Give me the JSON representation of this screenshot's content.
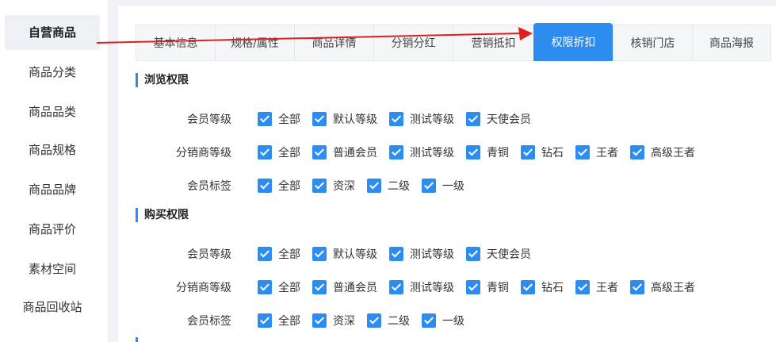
{
  "sidebar": {
    "items": [
      {
        "label": "自营商品",
        "active": true
      },
      {
        "label": "商品分类"
      },
      {
        "label": "商品品类"
      },
      {
        "label": "商品规格"
      },
      {
        "label": "商品品牌"
      },
      {
        "label": "商品评价"
      },
      {
        "label": "素材空间"
      },
      {
        "label": "商品回收站"
      }
    ]
  },
  "tabs": [
    {
      "label": "基本信息"
    },
    {
      "label": "规格/属性"
    },
    {
      "label": "商品详情"
    },
    {
      "label": "分销分红"
    },
    {
      "label": "营销抵扣"
    },
    {
      "label": "权限折扣",
      "active": true
    },
    {
      "label": "核销门店"
    },
    {
      "label": "商品海报"
    }
  ],
  "browse": {
    "title": "浏览权限",
    "member_level": {
      "label": "会员等级",
      "options": [
        "全部",
        "默认等级",
        "测试等级",
        "天使会员"
      ]
    },
    "distributor_level": {
      "label": "分销商等级",
      "options": [
        "全部",
        "普通会员",
        "测试等级",
        "青铜",
        "钻石",
        "王者",
        "高级王者"
      ]
    },
    "member_tag": {
      "label": "会员标签",
      "options": [
        "全部",
        "资深",
        "二级",
        "一级"
      ]
    }
  },
  "purchase": {
    "title": "购买权限",
    "member_level": {
      "label": "会员等级",
      "options": [
        "全部",
        "默认等级",
        "测试等级",
        "天使会员"
      ]
    },
    "distributor_level": {
      "label": "分销商等级",
      "options": [
        "全部",
        "普通会员",
        "测试等级",
        "青铜",
        "钻石",
        "王者",
        "高级王者"
      ]
    },
    "member_tag": {
      "label": "会员标签",
      "options": [
        "全部",
        "资深",
        "二级",
        "一级"
      ]
    }
  },
  "colors": {
    "accent": "#2d8cf0",
    "annotation_arrow": "#e02020"
  }
}
